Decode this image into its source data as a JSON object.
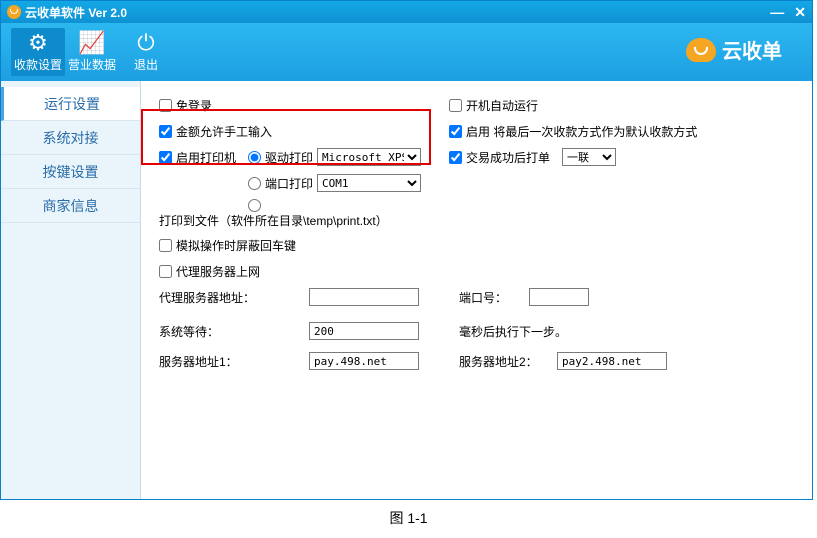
{
  "window": {
    "title": "云收单软件  Ver 2.0"
  },
  "toolbar": {
    "items": [
      {
        "icon": "⚙",
        "label": "收款设置"
      },
      {
        "icon": "📈",
        "label": "营业数据"
      },
      {
        "icon": "⏻",
        "label": "退出"
      }
    ],
    "brand": "云收单"
  },
  "sidebar": {
    "items": [
      "运行设置",
      "系统对接",
      "按键设置",
      "商家信息"
    ]
  },
  "settings": {
    "free_login": "免登录",
    "auto_run": "开机自动运行",
    "manual_amount": "金额允许手工输入",
    "use_last_method": "启用 将最后一次收款方式作为默认收款方式",
    "enable_printer": "启用打印机",
    "driver_print": "驱动打印",
    "port_print": "端口打印",
    "printer_select": "Microsoft XPS D",
    "port_select": "COM1",
    "print_after_success": "交易成功后打单",
    "copies_select": "一联",
    "print_to_file": "打印到文件（软件所在目录\\temp\\print.txt）",
    "shield_enter": "模拟操作时屏蔽回车键",
    "proxy_enabled": "代理服务器上网",
    "proxy_addr_label": "代理服务器地址：",
    "proxy_port_label": "端口号：",
    "sys_wait_label": "系统等待：",
    "sys_wait_value": "200",
    "sys_wait_suffix": "毫秒后执行下一步。",
    "server1_label": "服务器地址1：",
    "server1_value": "pay.498.net",
    "server2_label": "服务器地址2：",
    "server2_value": "pay2.498.net"
  },
  "caption": "图 1-1"
}
